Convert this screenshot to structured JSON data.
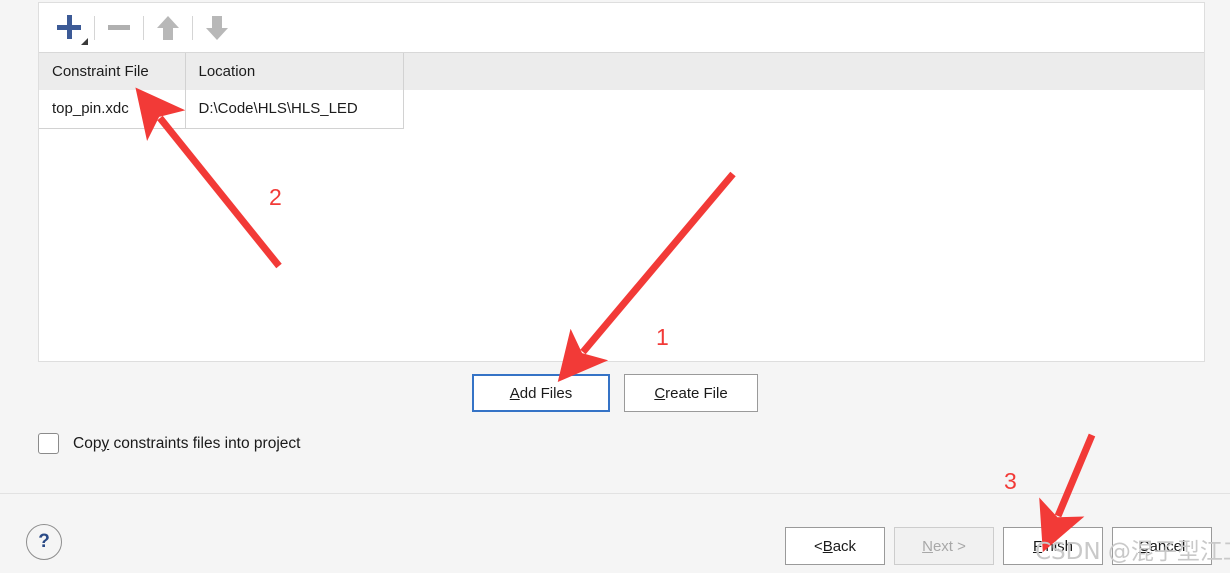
{
  "dialog": {
    "toolbar": {
      "add_icon": "plus-icon",
      "remove_icon": "minus-icon",
      "move_up_icon": "arrow-up-icon",
      "move_down_icon": "arrow-down-icon"
    },
    "table": {
      "columns": [
        "Constraint File",
        "Location"
      ],
      "rows": [
        {
          "constraint_file": "top_pin.xdc",
          "location": "D:\\Code\\HLS\\HLS_LED"
        }
      ]
    },
    "file_actions": {
      "add_files": {
        "prefix": "A",
        "rest": "dd Files"
      },
      "create_file": {
        "prefix": "C",
        "rest": "reate File"
      }
    },
    "copy_option": {
      "pre": "Cop",
      "mnemonic": "y",
      "post": " constraints files into project",
      "checked": false
    },
    "help": {
      "glyph": "?"
    },
    "navigation": {
      "back": {
        "pre": "< ",
        "mnemonic": "B",
        "post": "ack"
      },
      "next": {
        "pre": "",
        "mnemonic": "N",
        "post": "ext >"
      },
      "finish": {
        "pre": "",
        "mnemonic": "F",
        "post": "inish"
      },
      "cancel": {
        "pre": "",
        "mnemonic": "C",
        "post": "ancel"
      }
    }
  },
  "annotations": {
    "numbers": [
      "1",
      "2",
      "3"
    ],
    "color": "#f23a37"
  },
  "watermark": {
    "text": "CSDN @混子型江工"
  },
  "colors": {
    "accent_blue": "#3573c6",
    "plus_blue": "#3c5a96",
    "panel_bg": "#ffffff",
    "window_bg": "#f5f5f5",
    "header_bg": "#ececec",
    "annotation_red": "#f23a37"
  }
}
